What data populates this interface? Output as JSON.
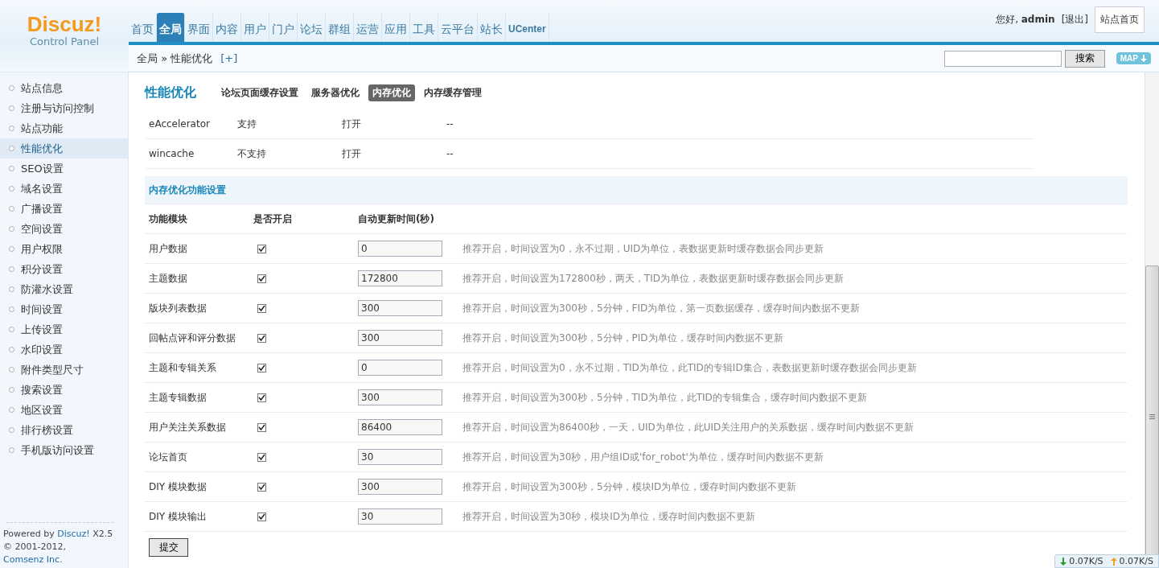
{
  "logo": {
    "title": "Discuz!",
    "subtitle": "Control Panel"
  },
  "nav": {
    "items": [
      {
        "label": "首页",
        "selected": false
      },
      {
        "label": "全局",
        "selected": true
      },
      {
        "label": "界面",
        "selected": false
      },
      {
        "label": "内容",
        "selected": false
      },
      {
        "label": "用户",
        "selected": false
      },
      {
        "label": "门户",
        "selected": false
      },
      {
        "label": "论坛",
        "selected": false
      },
      {
        "label": "群组",
        "selected": false
      },
      {
        "label": "运营",
        "selected": false
      },
      {
        "label": "应用",
        "selected": false
      },
      {
        "label": "工具",
        "selected": false
      },
      {
        "label": "云平台",
        "selected": false
      },
      {
        "label": "站长",
        "selected": false
      },
      {
        "label": "UCenter",
        "selected": false
      }
    ]
  },
  "user": {
    "greeting": "您好, **admin**",
    "logout": "[退出]",
    "home_button": "站点首页"
  },
  "breadcrumb": {
    "path": "全局 » 性能优化",
    "add": "[+]"
  },
  "search": {
    "button": "搜索",
    "map": "MAP"
  },
  "sidebar": {
    "items": [
      {
        "label": "站点信息",
        "selected": false
      },
      {
        "label": "注册与访问控制",
        "selected": false
      },
      {
        "label": "站点功能",
        "selected": false
      },
      {
        "label": "性能优化",
        "selected": true
      },
      {
        "label": "SEO设置",
        "selected": false
      },
      {
        "label": "域名设置",
        "selected": false
      },
      {
        "label": "广播设置",
        "selected": false
      },
      {
        "label": "空间设置",
        "selected": false
      },
      {
        "label": "用户权限",
        "selected": false
      },
      {
        "label": "积分设置",
        "selected": false
      },
      {
        "label": "防灌水设置",
        "selected": false
      },
      {
        "label": "时间设置",
        "selected": false
      },
      {
        "label": "上传设置",
        "selected": false
      },
      {
        "label": "水印设置",
        "selected": false
      },
      {
        "label": "附件类型尺寸",
        "selected": false
      },
      {
        "label": "搜索设置",
        "selected": false
      },
      {
        "label": "地区设置",
        "selected": false
      },
      {
        "label": "排行榜设置",
        "selected": false
      },
      {
        "label": "手机版访问设置",
        "selected": false
      }
    ],
    "footer": {
      "powered_prefix": "Powered by",
      "powered_link": "Discuz!",
      "powered_suffix": "X2.5",
      "copyright_prefix": "© 2001-2012,",
      "copyright_link": "Comsenz Inc."
    }
  },
  "page": {
    "title": "性能优化",
    "tabs": [
      {
        "label": "论坛页面缓存设置",
        "selected": false
      },
      {
        "label": "服务器优化",
        "selected": false
      },
      {
        "label": "内存优化",
        "selected": true
      },
      {
        "label": "内存缓存管理",
        "selected": false
      }
    ]
  },
  "extensions": [
    {
      "name": "eAccelerator",
      "support": "支持",
      "status": "打开",
      "note": "--"
    },
    {
      "name": "wincache",
      "support": "不支持",
      "status": "打开",
      "note": "--"
    }
  ],
  "settings": {
    "title": "内存优化功能设置",
    "columns": [
      "功能模块",
      "是否开启",
      "自动更新时间(秒)"
    ],
    "rows": [
      {
        "name": "用户数据",
        "checked": true,
        "value": "0",
        "hint": "推荐开启，时间设置为0，永不过期，UID为单位，表数据更新时缓存数据会同步更新"
      },
      {
        "name": "主题数据",
        "checked": true,
        "value": "172800",
        "hint": "推荐开启，时间设置为172800秒，两天，TID为单位，表数据更新时缓存数据会同步更新"
      },
      {
        "name": "版块列表数据",
        "checked": true,
        "value": "300",
        "hint": "推荐开启，时间设置为300秒，5分钟，FID为单位，第一页数据缓存，缓存时间内数据不更新"
      },
      {
        "name": "回帖点评和评分数据",
        "checked": true,
        "value": "300",
        "hint": "推荐开启，时间设置为300秒，5分钟，PID为单位，缓存时间内数据不更新"
      },
      {
        "name": "主题和专辑关系",
        "checked": true,
        "value": "0",
        "hint": "推荐开启，时间设置为0，永不过期，TID为单位，此TID的专辑ID集合，表数据更新时缓存数据会同步更新"
      },
      {
        "name": "主题专辑数据",
        "checked": true,
        "value": "300",
        "hint": "推荐开启，时间设置为300秒，5分钟，TID为单位，此TID的专辑集合，缓存时间内数据不更新"
      },
      {
        "name": "用户关注关系数据",
        "checked": true,
        "value": "86400",
        "hint": "推荐开启，时间设置为86400秒，一天，UID为单位，此UID关注用户的关系数据，缓存时间内数据不更新"
      },
      {
        "name": "论坛首页",
        "checked": true,
        "value": "30",
        "hint": "推荐开启，时间设置为30秒，用户组ID或'for_robot'为单位，缓存时间内数据不更新"
      },
      {
        "name": "DIY 模块数据",
        "checked": true,
        "value": "300",
        "hint": "推荐开启，时间设置为300秒，5分钟，模块ID为单位，缓存时间内数据不更新"
      },
      {
        "name": "DIY 模块输出",
        "checked": true,
        "value": "30",
        "hint": "推荐开启，时间设置为30秒，模块ID为单位，缓存时间内数据不更新"
      }
    ],
    "submit": "提交"
  },
  "speed": {
    "down": "0.07K/S",
    "up": "0.07K/S"
  }
}
